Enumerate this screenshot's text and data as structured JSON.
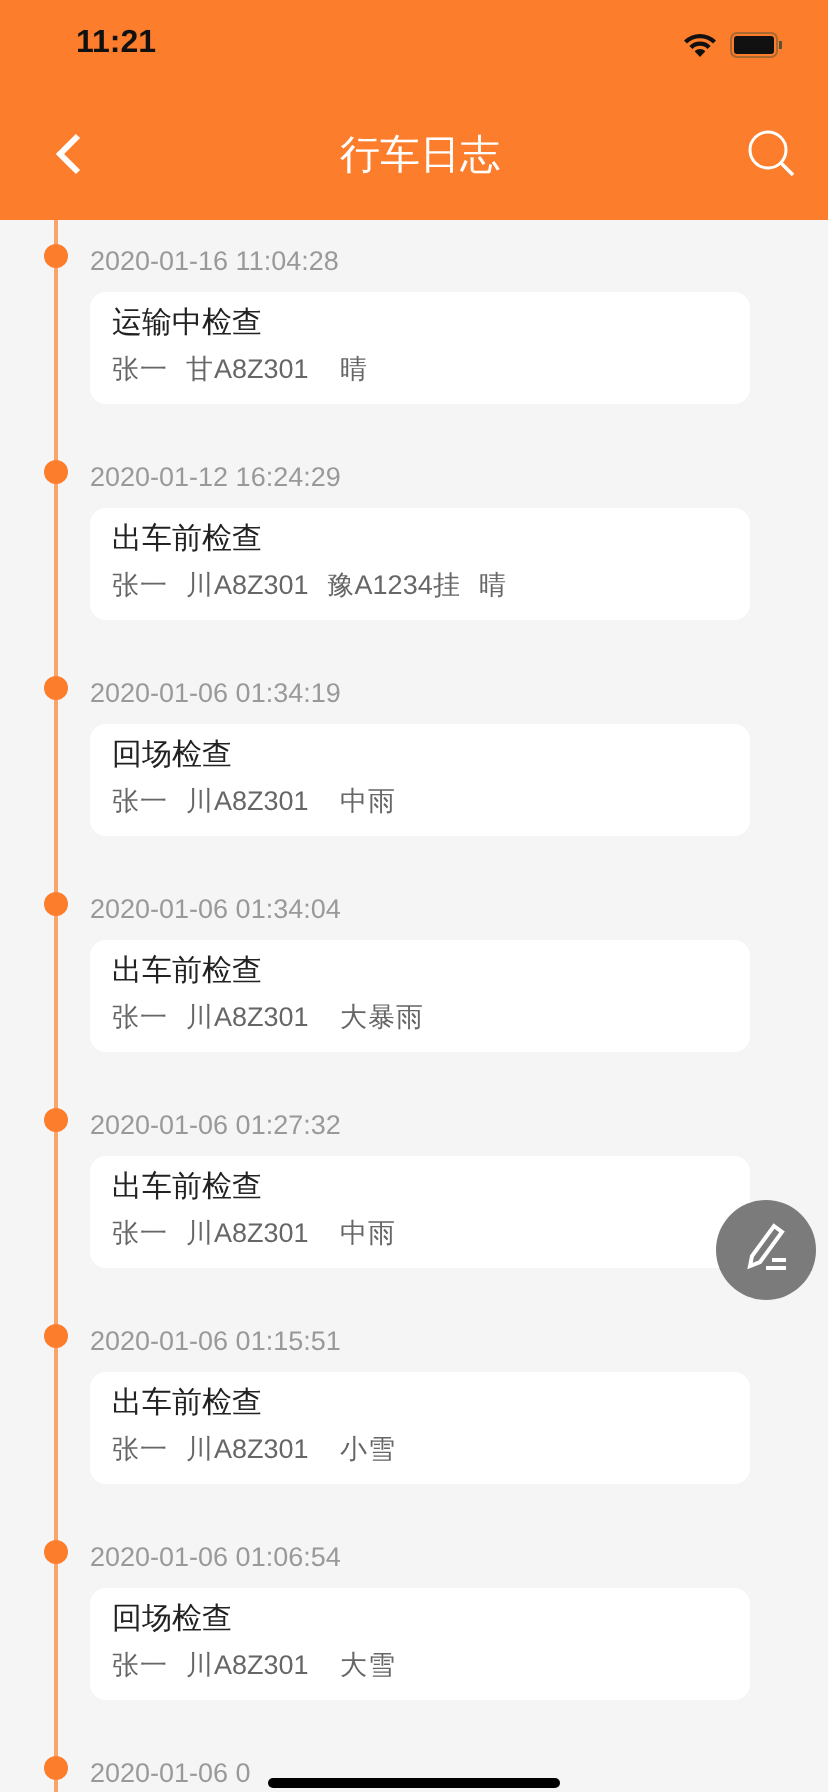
{
  "status_bar": {
    "time": "11:21"
  },
  "nav": {
    "title": "行车日志"
  },
  "entries": [
    {
      "time": "2020-01-16 11:04:28",
      "type": "运输中检查",
      "driver": "张一",
      "plate": "甘A8Z301",
      "weather": "晴"
    },
    {
      "time": "2020-01-12 16:24:29",
      "type": "出车前检查",
      "driver": "张一",
      "plate": "川A8Z301",
      "trailer": "豫A1234挂",
      "weather": "晴"
    },
    {
      "time": "2020-01-06 01:34:19",
      "type": "回场检查",
      "driver": "张一",
      "plate": "川A8Z301",
      "weather": "中雨"
    },
    {
      "time": "2020-01-06 01:34:04",
      "type": "出车前检查",
      "driver": "张一",
      "plate": "川A8Z301",
      "weather": "大暴雨"
    },
    {
      "time": "2020-01-06 01:27:32",
      "type": "出车前检查",
      "driver": "张一",
      "plate": "川A8Z301",
      "weather": "中雨"
    },
    {
      "time": "2020-01-06 01:15:51",
      "type": "出车前检查",
      "driver": "张一",
      "plate": "川A8Z301",
      "weather": "小雪"
    },
    {
      "time": "2020-01-06 01:06:54",
      "type": "回场检查",
      "driver": "张一",
      "plate": "川A8Z301",
      "weather": "大雪"
    },
    {
      "time": "2020-01-06 0"
    }
  ]
}
